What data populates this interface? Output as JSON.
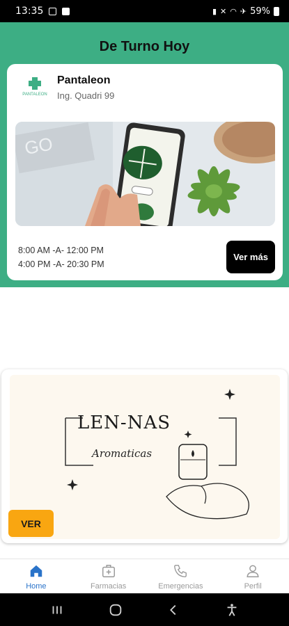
{
  "status_bar": {
    "time": "13:35",
    "battery": "59%"
  },
  "header": {
    "title": "De Turno Hoy"
  },
  "pharmacy_card": {
    "logo_text": "PANTALEON",
    "name": "Pantaleon",
    "address": "Ing. Quadri 99",
    "hours_line_1": "8:00 AM -A- 12:00 PM",
    "hours_line_2": "4:00 PM -A- 20:30 PM",
    "button_label": "Ver más"
  },
  "banner": {
    "title": "LEN-NAS",
    "subtitle": "Aromaticas",
    "button_label": "VER"
  },
  "bottom_nav": {
    "items": [
      {
        "label": "Home",
        "icon": "home-icon",
        "active": true
      },
      {
        "label": "Farmacias",
        "icon": "first-aid-kit-icon",
        "active": false
      },
      {
        "label": "Emergencias",
        "icon": "phone-icon",
        "active": false
      },
      {
        "label": "Perfil",
        "icon": "user-icon",
        "active": false
      }
    ]
  },
  "colors": {
    "header_green": "#3dae84",
    "nav_active": "#2a73c9",
    "ver_button": "#f9a611"
  }
}
